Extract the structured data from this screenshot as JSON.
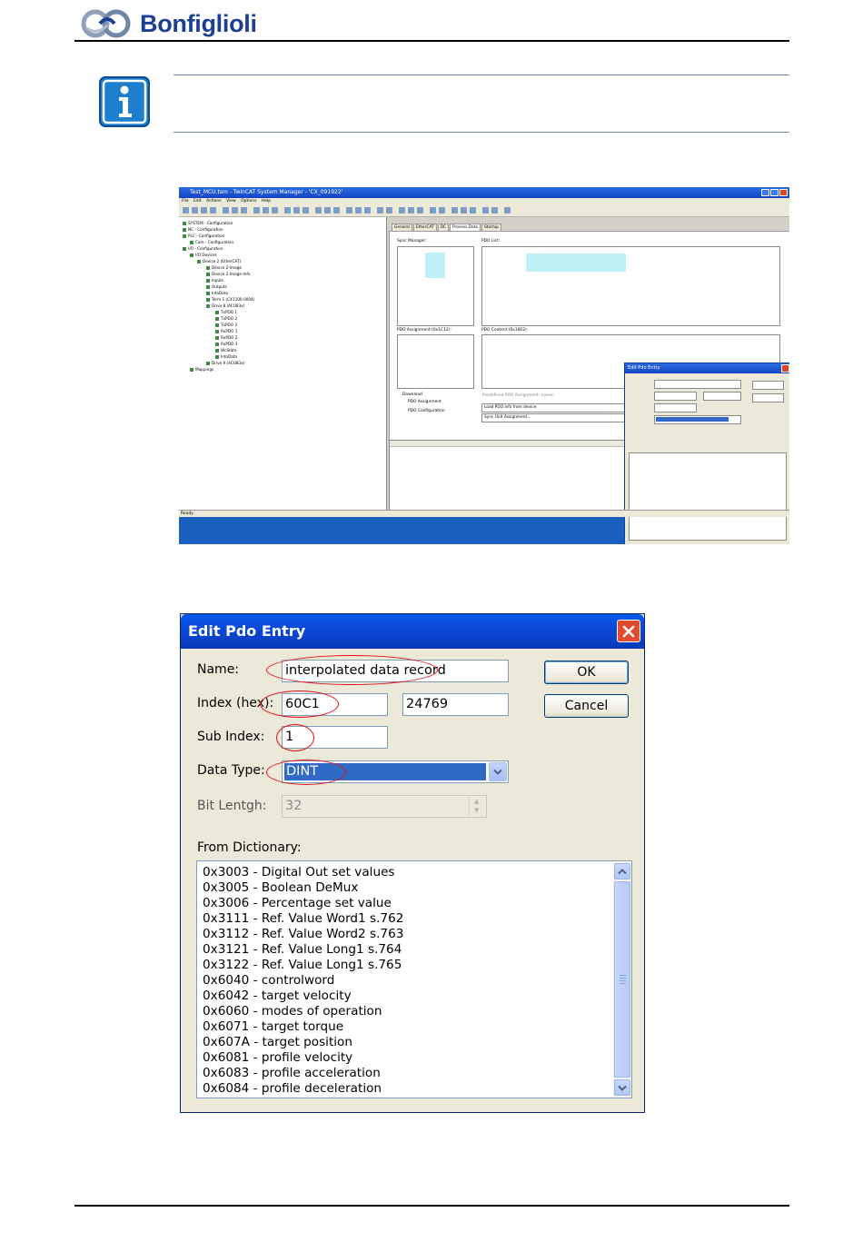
{
  "brand": {
    "name": "Bonfiglioli",
    "color": "#1b3f93"
  },
  "screenshot": {
    "title": "Test_MCU.tsm - TwinCAT System Manager - 'CX_091922'",
    "menu": "File  Edit  Actions  View  Options  Help",
    "tree": [
      "SYSTEM - Configuration",
      "NC - Configuration",
      "PLC - Configuration",
      "Cam - Configuration",
      "I/O - Configuration",
      "I/O Devices",
      "Device 2 (EtherCAT)",
      "Device 2-Image",
      "Device 2-Image-Info",
      "Inputs",
      "Outputs",
      "InfoData",
      "Term 1 (CX1100-0004)",
      "Drive 8 (ACU83x)",
      "TxPDO 1",
      "TxPDO 2",
      "TxPDO 3",
      "RxPDO 1",
      "RxPDO 2",
      "RxPDO 3",
      "WcState",
      "InfoData",
      "Drive 9 (ACU83x)",
      "Mappings"
    ],
    "tabs": [
      "General",
      "EtherCAT",
      "DC",
      "Process Data",
      "Startup"
    ],
    "sync_manager_label": "Sync Manager:",
    "pdo_list_label": "PDO List:",
    "pdo_assignment_label": "PDO Assignment (0x1C12):",
    "pdo_content_label": "PDO Content (0x1602):",
    "download_label": "Download",
    "pdo_assign_check": "PDO Assignment",
    "pdo_config_check": "PDO Configuration",
    "predefined": "Predefined PDO Assignment: (none)",
    "load_pdo": "Load PDO info from device",
    "sync_unit": "Sync Unit Assignment...",
    "status": "Ready",
    "mini_dialog_title": "Edit Pdo Entry"
  },
  "dialog": {
    "title": "Edit Pdo Entry",
    "name_label": "Name:",
    "name_value": "interpolated data record",
    "index_label": "Index (hex):",
    "index_hex": "60C1",
    "index_dec": "24769",
    "subindex_label": "Sub Index:",
    "subindex_value": "1",
    "datatype_label": "Data Type:",
    "datatype_value": "DINT",
    "bitlength_label": "Bit Lentgh:",
    "bitlength_value": "32",
    "ok_label": "OK",
    "cancel_label": "Cancel",
    "dictionary_label": "From Dictionary:",
    "dictionary": [
      "0x3003 - Digital Out set values",
      "0x3005 - Boolean DeMux",
      "0x3006 - Percentage set value",
      "0x3111 - Ref. Value Word1 s.762",
      "0x3112 - Ref. Value Word2 s.763",
      "0x3121 - Ref. Value Long1 s.764",
      "0x3122 - Ref. Value Long1 s.765",
      "0x6040 - controlword",
      "0x6042 - target velocity",
      "0x6060 - modes of operation",
      "0x6071 - target torque",
      "0x607A - target position",
      "0x6081 - profile velocity",
      "0x6083 - profile acceleration",
      "0x6084 - profile deceleration"
    ]
  },
  "colors": {
    "highlight_ring": "#e3101a",
    "selection": "#316ac5",
    "titlebar": "#0a49d8"
  }
}
